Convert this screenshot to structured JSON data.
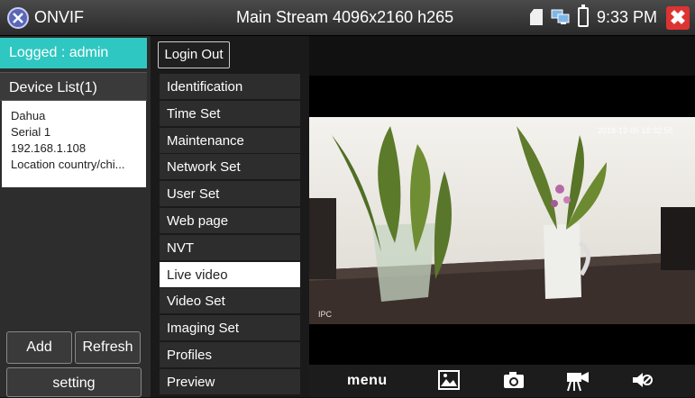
{
  "header": {
    "app_name": "ONVIF",
    "stream_title": "Main Stream 4096x2160 h265",
    "clock": "9:33 PM",
    "close_glyph": "✖"
  },
  "left": {
    "logged_in": "Logged : admin",
    "device_list_header": "Device List(1)",
    "device": {
      "name": "Dahua",
      "serial": "Serial 1",
      "ip": "192.168.1.108",
      "location": "Location country/chi..."
    },
    "add_label": "Add",
    "refresh_label": "Refresh",
    "setting_label": "setting"
  },
  "menu": {
    "login_out": "Login Out",
    "items": [
      {
        "label": "Identification"
      },
      {
        "label": "Time Set"
      },
      {
        "label": "Maintenance"
      },
      {
        "label": "Network Set"
      },
      {
        "label": "User Set"
      },
      {
        "label": "Web page"
      },
      {
        "label": "NVT"
      },
      {
        "label": "Live video"
      },
      {
        "label": "Video Set"
      },
      {
        "label": "Imaging Set"
      },
      {
        "label": "Profiles"
      },
      {
        "label": "Preview"
      }
    ],
    "active_item": "Live video"
  },
  "video": {
    "timestamp": "2018-12-05 18:32:56",
    "channel_label": "IPC"
  },
  "toolbar": {
    "menu_label": "menu",
    "icons": [
      "image-icon",
      "camera-icon",
      "record-icon",
      "mute-icon"
    ]
  },
  "colors": {
    "accent": "#2fc7c1",
    "close_red": "#dd3333",
    "logo_blue": "#5b66b8"
  }
}
